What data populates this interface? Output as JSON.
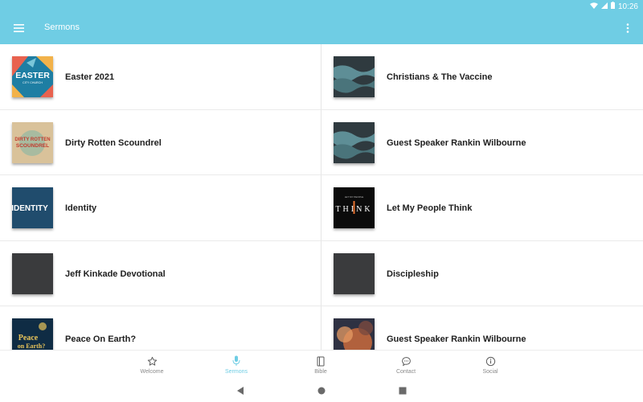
{
  "status": {
    "time": "10:26",
    "icons": [
      "wifi-icon",
      "signal-icon",
      "battery-icon"
    ]
  },
  "appbar": {
    "title": "Sermons",
    "menu_icon": "hamburger-menu-icon",
    "overflow_icon": "more-vert-icon",
    "color": "#6fcde4"
  },
  "sermons": [
    {
      "title": "Easter 2021",
      "thumb_text": "EASTER",
      "thumb_sub": "CITY CHURCH"
    },
    {
      "title": "Christians & The Vaccine"
    },
    {
      "title": "Dirty Rotten Scoundrel",
      "thumb_text": "DIRTY ROTTEN",
      "thumb_sub": "SCOUNDREL"
    },
    {
      "title": "Guest Speaker Rankin Wilbourne"
    },
    {
      "title": "Identity",
      "thumb_text": "IDENTITY"
    },
    {
      "title": "Let My People Think",
      "thumb_text": "THINK",
      "thumb_sub": "LET MY PEOPLE"
    },
    {
      "title": "Jeff Kinkade Devotional"
    },
    {
      "title": "Discipleship"
    },
    {
      "title": "Peace On Earth?",
      "thumb_text": "Peace",
      "thumb_sub": "on Earth?"
    },
    {
      "title": "Guest Speaker Rankin Wilbourne"
    }
  ],
  "bottomnav": {
    "items": [
      {
        "label": "Welcome",
        "icon": "star-icon"
      },
      {
        "label": "Sermons",
        "icon": "microphone-icon",
        "active": true
      },
      {
        "label": "Bible",
        "icon": "book-icon"
      },
      {
        "label": "Contact",
        "icon": "chat-bubble-icon"
      },
      {
        "label": "Social",
        "icon": "info-icon"
      }
    ]
  },
  "system_nav": [
    "back-icon",
    "home-icon",
    "recents-icon"
  ]
}
